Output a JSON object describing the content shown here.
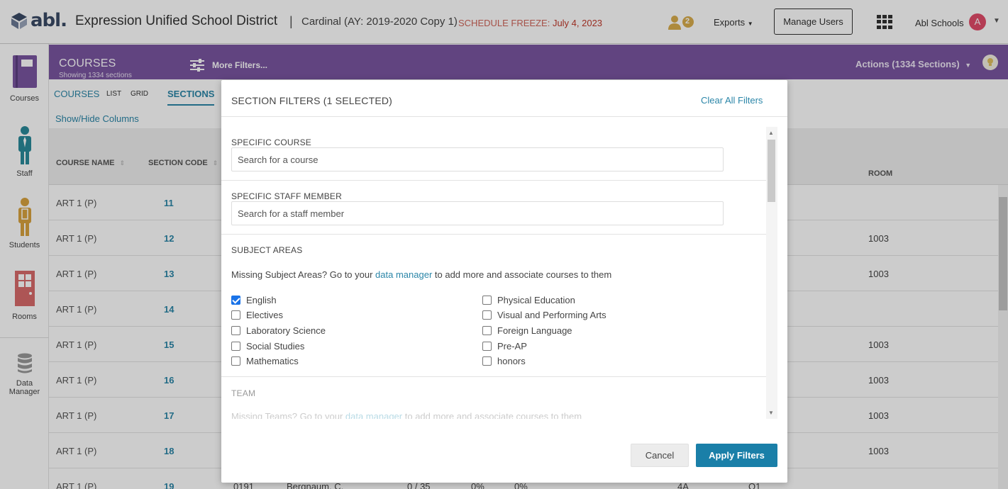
{
  "header": {
    "logo_text": "abl.",
    "district": "Expression Unified School District",
    "separator": "|",
    "schedule_name": "Cardinal (AY: 2019-2020 Copy 1)",
    "freeze_label": "SCHEDULE FREEZE:",
    "freeze_date": "July 4, 2023",
    "notification_count": "2",
    "exports_label": "Exports",
    "manage_users_label": "Manage Users",
    "school_label": "Abl Schools",
    "avatar_initial": "A"
  },
  "sidebar": {
    "items": [
      {
        "label": "Courses",
        "icon": "book-icon"
      },
      {
        "label": "Staff",
        "icon": "staff-icon"
      },
      {
        "label": "Students",
        "icon": "student-icon"
      },
      {
        "label": "Rooms",
        "icon": "door-icon"
      },
      {
        "label": "Data",
        "label2": "Manager",
        "icon": "database-icon"
      }
    ]
  },
  "purplebar": {
    "title": "COURSES",
    "subtitle": "Showing 1334 sections",
    "more_filters": "More Filters...",
    "actions": "Actions (1334 Sections)"
  },
  "tabs": {
    "courses": "COURSES",
    "list": "LIST",
    "grid": "GRID",
    "sections": "SECTIONS"
  },
  "show_hide": "Show/Hide Columns",
  "table": {
    "headers": {
      "course_name": "COURSE NAME",
      "section_code": "SECTION CODE",
      "room": "ROOM"
    },
    "rows": [
      {
        "course": "ART 1 (P)",
        "code": "11",
        "room": ""
      },
      {
        "course": "ART 1 (P)",
        "code": "12",
        "room": "1003"
      },
      {
        "course": "ART 1 (P)",
        "code": "13",
        "room": "1003"
      },
      {
        "course": "ART 1 (P)",
        "code": "14",
        "room": ""
      },
      {
        "course": "ART 1 (P)",
        "code": "15",
        "room": "1003"
      },
      {
        "course": "ART 1 (P)",
        "code": "16",
        "room": "1003"
      },
      {
        "course": "ART 1 (P)",
        "code": "17",
        "room": "1003"
      },
      {
        "course": "ART 1 (P)",
        "code": "18",
        "room": "1003"
      },
      {
        "course": "ART 1 (P)",
        "code": "19",
        "room": ""
      }
    ],
    "partial_row": {
      "c1": "0191",
      "c2": "Bergnaum, C.",
      "c3": "0 / 35",
      "c4": "0%",
      "c5": "0%",
      "c6": "4A",
      "c7": "Q1"
    }
  },
  "modal": {
    "title": "SECTION FILTERS (1 SELECTED)",
    "clear_all": "Clear All Filters",
    "specific_course_label": "SPECIFIC COURSE",
    "specific_course_placeholder": "Search for a course",
    "specific_staff_label": "SPECIFIC STAFF MEMBER",
    "specific_staff_placeholder": "Search for a staff member",
    "subject_areas_label": "SUBJECT AREAS",
    "missing_subject_pre": "Missing Subject Areas? Go to your ",
    "missing_subject_link": "data manager",
    "missing_subject_post": " to add more and associate courses to them",
    "subjects_left": [
      {
        "label": "English",
        "checked": true
      },
      {
        "label": "Electives",
        "checked": false
      },
      {
        "label": "Laboratory Science",
        "checked": false
      },
      {
        "label": "Social Studies",
        "checked": false
      },
      {
        "label": "Mathematics",
        "checked": false
      }
    ],
    "subjects_right": [
      {
        "label": "Physical Education",
        "checked": false
      },
      {
        "label": "Visual and Performing Arts",
        "checked": false
      },
      {
        "label": "Foreign Language",
        "checked": false
      },
      {
        "label": "Pre-AP",
        "checked": false
      },
      {
        "label": "honors",
        "checked": false
      }
    ],
    "team_label": "TEAM",
    "missing_team_pre": "Missing Teams? Go to your ",
    "missing_team_link": "data manager",
    "missing_team_post": " to add more and associate courses to them",
    "cancel_label": "Cancel",
    "apply_label": "Apply Filters"
  },
  "colors": {
    "purple": "#7a55a1",
    "link": "#2b86a8",
    "apply": "#1a7fa8",
    "freeze": "#c0392b"
  }
}
